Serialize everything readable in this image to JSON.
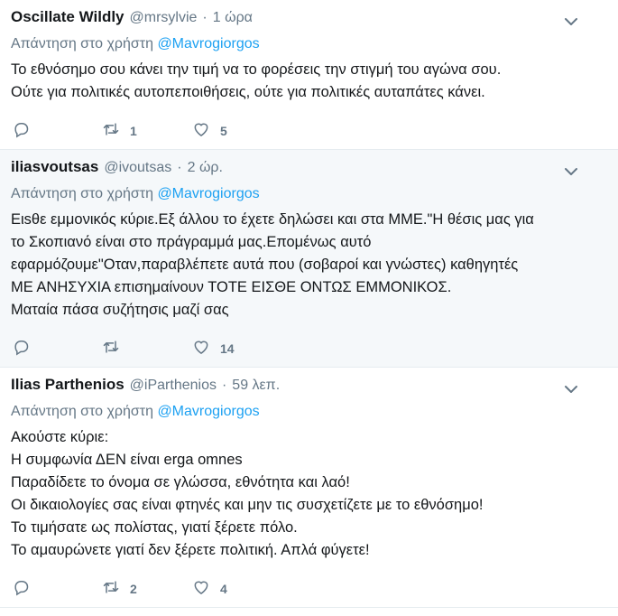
{
  "tweets": [
    {
      "name": "Oscillate Wildly",
      "handle": "@mrsylvie",
      "time": "1 ώρα",
      "reply_prefix": "Απάντηση στο χρήστη",
      "reply_mention": "@Mavrogiorgos",
      "lines": [
        "Το εθνόσημο σου κάνει την τιμή να το φορέσεις την στιγμή του αγώνα σου.",
        "Ούτε για πολιτικές αυτοπεποιθήσεις, ούτε για πολιτικές αυταπάτες κάνει."
      ],
      "replies": "",
      "retweets": "1",
      "likes": "5"
    },
    {
      "name": "iliasvoutsas",
      "handle": "@ivoutsas",
      "time": "2 ώρ.",
      "reply_prefix": "Απάντηση στο χρήστη",
      "reply_mention": "@Mavrogiorgos",
      "lines": [
        "Ειsθε εμμονικός κύριε.Εξ άλλου το έχετε δηλώσει και στα ΜΜΕ.\"Η θέσις μας για",
        "το Σκοπιανό είναι στο πράγραμμά μας.Επομένως αυτό",
        "εφαρμόζουμε\"Οταν,παραβλέπετε αυτά που (σοβαροί και γνώστες) καθηγητές",
        "ΜΕ ΑΝΗΣΥΧΙΑ επισημαίνουν ΤΟΤΕ ΕΙΣΘΕ ΟΝΤΩΣ ΕΜΜΟΝΙΚΟΣ.",
        "Ματαία πάσα συζήτησις μαζί σας"
      ],
      "replies": "",
      "retweets": "",
      "likes": "14"
    },
    {
      "name": "Ilias Parthenios",
      "handle": "@iParthenios",
      "time": "59 λεπ.",
      "reply_prefix": "Απάντηση στο χρήστη",
      "reply_mention": "@Mavrogiorgos",
      "lines": [
        "Ακούστε κύριε:",
        "Η συμφωνία ΔΕΝ είναι erga omnes",
        "Παραδίδετε το όνομα σε γλώσσα, εθνότητα και λαό!",
        "Οι δικαιολογίες σας είναι φτηνές και μην τις συσχετίζετε με το εθνόσημο!",
        "Το τιμήσατε ως πολίστας, γιατί ξέρετε πόλο.",
        "Το αμαυρώνετε γιατί δεν ξέρετε πολιτική. Απλά φύγετε!"
      ],
      "replies": "",
      "retweets": "2",
      "likes": "4"
    }
  ],
  "icons": {
    "reply": "reply-icon",
    "retweet": "retweet-icon",
    "like": "heart-icon",
    "caret": "chevron-down-icon"
  },
  "colors": {
    "secondary_text": "#657786",
    "mention": "#1da1f2",
    "divider": "#e6ecf0",
    "highlight_bg": "#f5f8fa"
  }
}
